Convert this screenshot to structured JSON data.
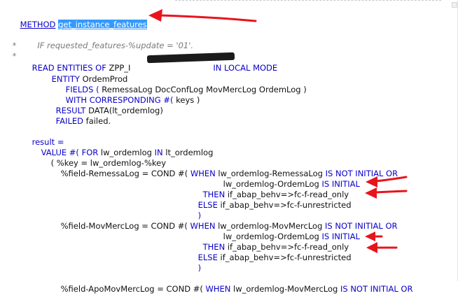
{
  "editor": {
    "lines": {
      "method_kw": "METHOD",
      "method_name": "get_instance_features",
      "comment_star1": "*",
      "comment_text": "IF requested_features-%update = '01'.",
      "comment_star2": "*",
      "read_kw1": "READ ENTITIES OF",
      "read_entity": "ZPP_I",
      "read_kw2": "IN LOCAL MODE",
      "entity_kw": "ENTITY",
      "entity_name": "OrdemProd",
      "fields_kw": "FIELDS (",
      "fields_list": "RemessaLog DocConfLog MovMercLog OrdemLog )",
      "with_kw": "WITH CORRESPONDING #(",
      "with_rest": "keys )",
      "result_kw": "RESULT",
      "result_rest": "DATA(lt_ordemlog)",
      "failed_kw": "FAILED",
      "failed_rest": "failed.",
      "res_assign": "result =",
      "value_kw": "VALUE #(",
      "for_kw": "FOR",
      "for_var": "lw_ordemlog",
      "in_kw": "IN",
      "for_tab": "lt_ordemlog",
      "key_line": "( %key = lw_ordemlog-%key",
      "f1_field": "%field-RemessaLog = COND #(",
      "f1_when": "WHEN",
      "f1_cond1": "lw_ordemlog-RemessaLog",
      "f1_isnot": "IS NOT INITIAL OR",
      "f1_cond2": "lw_ordemlog-OrdemLog",
      "f1_is": "IS INITIAL",
      "f1_then": "THEN",
      "f1_then_val": "if_abap_behv=>fc-f-read_only",
      "f1_else": "ELSE",
      "f1_else_val": "if_abap_behv=>fc-f-unrestricted",
      "f1_close": ")",
      "f2_field": "%field-MovMercLog = COND #(",
      "f2_when": "WHEN",
      "f2_cond1": "lw_ordemlog-MovMercLog",
      "f2_isnot": "IS NOT INITIAL OR",
      "f2_cond2": "lw_ordemlog-OrdemLog",
      "f2_is": "IS INITIAL",
      "f2_then": "THEN",
      "f2_then_val": "if_abap_behv=>fc-f-read_only",
      "f2_else": "ELSE",
      "f2_else_val": "if_abap_behv=>fc-f-unrestricted",
      "f2_close": ")",
      "f3_partial": "%field-ApoMovMercLog = COND #(",
      "f3_when": "WHEN",
      "f3_cond": "lw_ordemlog-MovMercLog",
      "f3_isnot": "IS NOT INITIAL OR"
    }
  },
  "colors": {
    "keyword": "#0a00c8",
    "selection": "#3399ff",
    "annotation_arrow": "#e8141c"
  },
  "annotations": [
    "arrow",
    "arrow",
    "arrow",
    "arrow",
    "arrow",
    "arrow",
    "redaction-scribble"
  ]
}
